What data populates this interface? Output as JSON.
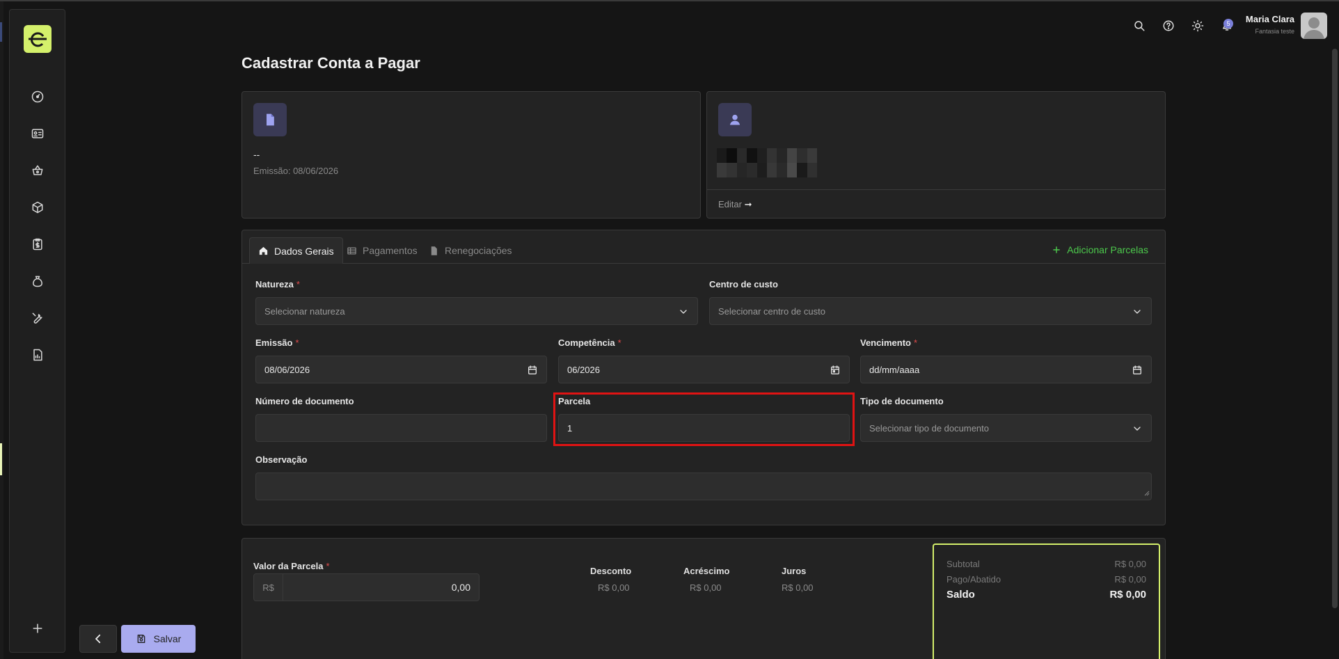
{
  "page": {
    "title": "Cadastrar Conta a Pagar"
  },
  "topbar": {
    "icons": [
      "search-icon",
      "help-icon",
      "sun-icon",
      "notification-icon"
    ],
    "notification_count": "5",
    "user_name": "Maria Clara",
    "user_company": "Fantasia teste"
  },
  "sidebar": {
    "icons": [
      "dashboard-icon",
      "contacts-card-icon",
      "basket-icon",
      "box-icon",
      "invoice-icon",
      "money-bag-icon",
      "tools-icon",
      "report-icon",
      "plus-icon"
    ]
  },
  "doc_card": {
    "number": "--",
    "emissao": "Emissão: 08/06/2026"
  },
  "supplier_card": {
    "edit_label": "Editar",
    "edit_arrow": "➞"
  },
  "tabs": {
    "dados_gerais": "Dados Gerais",
    "pagamentos": "Pagamentos",
    "renegociacoes": "Renegociações",
    "add_parcelas": "Adicionar Parcelas"
  },
  "form": {
    "natureza": {
      "label": "Natureza",
      "required": "*",
      "placeholder": "Selecionar natureza"
    },
    "centro_custo": {
      "label": "Centro de custo",
      "placeholder": "Selecionar centro de custo"
    },
    "emissao": {
      "label": "Emissão",
      "required": "*",
      "value": "08/06/2026"
    },
    "competencia": {
      "label": "Competência",
      "required": "*",
      "value": "06/2026"
    },
    "vencimento": {
      "label": "Vencimento",
      "required": "*",
      "value": "dd/mm/aaaa"
    },
    "numero_documento": {
      "label": "Número de documento",
      "value": ""
    },
    "parcela": {
      "label": "Parcela",
      "value": "1"
    },
    "tipo_documento": {
      "label": "Tipo de documento",
      "placeholder": "Selecionar tipo de documento"
    },
    "observacao": {
      "label": "Observação",
      "value": ""
    }
  },
  "values": {
    "valor_parcela_label": "Valor da Parcela",
    "valor_parcela_required": "*",
    "currency_prefix": "R$",
    "valor_parcela": "0,00",
    "desconto_label": "Desconto",
    "desconto": "R$ 0,00",
    "acrescimo_label": "Acréscimo",
    "acrescimo": "R$ 0,00",
    "juros_label": "Juros",
    "juros": "R$ 0,00"
  },
  "summary": {
    "subtotal_label": "Subtotal",
    "subtotal": "R$ 0,00",
    "pago_label": "Pago/Abatido",
    "pago": "R$ 0,00",
    "saldo_label": "Saldo",
    "saldo": "R$ 0,00"
  },
  "actions": {
    "save_label": "Salvar"
  },
  "colors": {
    "accent": "#d4f06b",
    "primary": "#a9abef",
    "success": "#4cc94c",
    "danger": "#e01313"
  }
}
